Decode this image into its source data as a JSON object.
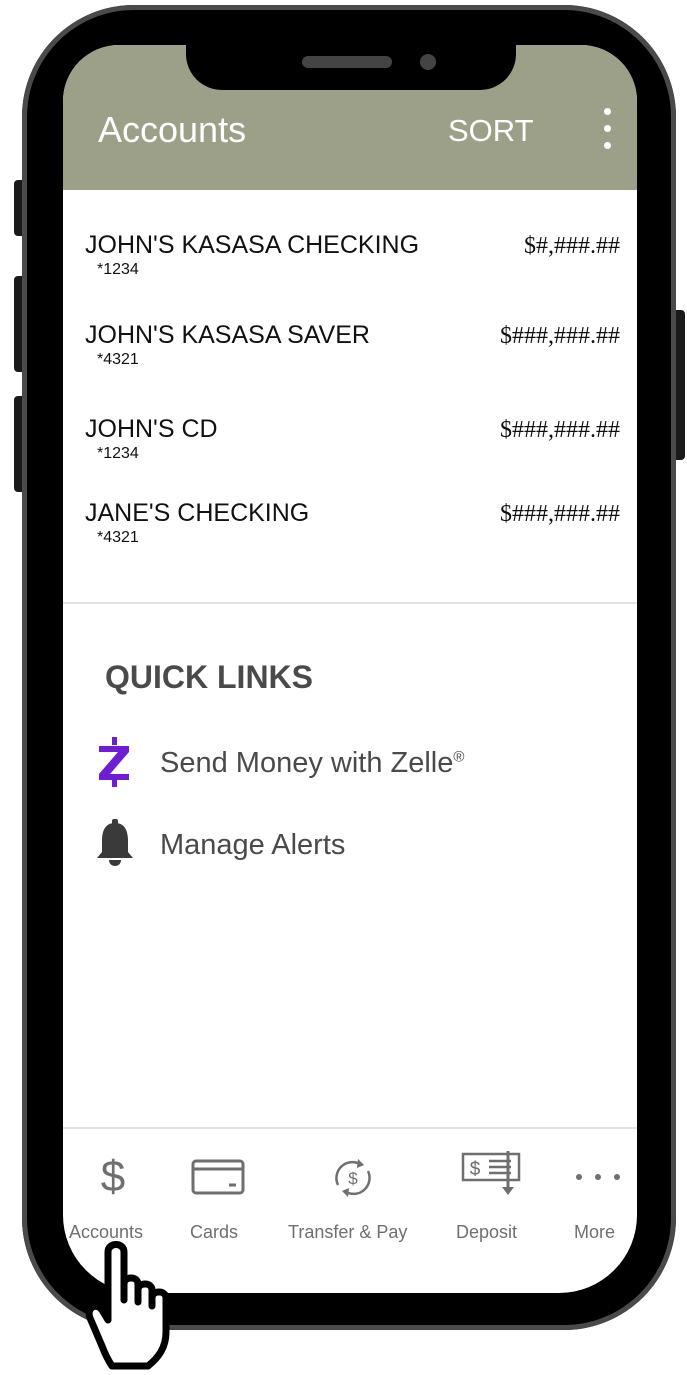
{
  "header": {
    "title": "Accounts",
    "sort_label": "SORT",
    "menu_icon": "kebab-menu-icon"
  },
  "accounts": [
    {
      "name": "JOHN'S KASASA CHECKING",
      "number": "*1234",
      "balance": "$#,###.##"
    },
    {
      "name": "JOHN'S KASASA SAVER",
      "number": "*4321",
      "balance": "$###,###.##"
    },
    {
      "name": "JOHN'S CD",
      "number": "*1234",
      "balance": "$###,###.##"
    },
    {
      "name": "JANE'S CHECKING",
      "number": "*4321",
      "balance": "$###,###.##"
    }
  ],
  "quick_links": {
    "title": "QUICK LINKS",
    "items": [
      {
        "label": "Send Money with Zelle",
        "trademark": "®",
        "icon": "zelle-icon",
        "icon_color": "#6d1ed4"
      },
      {
        "label": "Manage Alerts",
        "icon": "bell-icon"
      }
    ]
  },
  "tabs": [
    {
      "label": "Accounts",
      "icon": "dollar-icon"
    },
    {
      "label": "Cards",
      "icon": "card-icon"
    },
    {
      "label": "Transfer & Pay",
      "icon": "transfer-icon"
    },
    {
      "label": "Deposit",
      "icon": "check-deposit-icon"
    },
    {
      "label": "More",
      "icon": "more-icon"
    }
  ],
  "colors": {
    "header_bg": "#9da089",
    "tab_icon": "#6f6f6f",
    "zelle": "#6d1ed4",
    "text": "#4a4a4a"
  },
  "overlay": {
    "icon": "pointing-hand-icon"
  }
}
